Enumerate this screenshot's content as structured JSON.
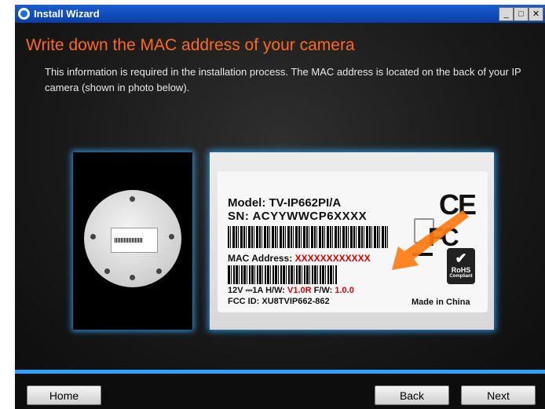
{
  "window": {
    "title": "Install Wizard",
    "controls": {
      "minimize": "_",
      "maximize": "□",
      "close": "✕"
    }
  },
  "main": {
    "heading": "Write down the MAC address of your camera",
    "description": "This information is required in the installation process. The MAC address is located on the back of your IP camera (shown in photo below)."
  },
  "label": {
    "model": "Model: TV-IP662PI/A",
    "sn": "SN: ACYYWWCP6XXXX",
    "mac_prefix": "MAC Address: ",
    "mac_value": "XXXXXXXXXXXX",
    "power_prefix": "12V ⎓1A  H/W: ",
    "hw_value": "V1.0R",
    "fw_prefix": "  F/W: ",
    "fw_value": "1.0.0",
    "fcc": "FCC ID: XU8TVIP662-862",
    "made_in": "Made in China",
    "ce": "CE",
    "fc": "FC",
    "rohs": "RoHS",
    "rohs_sub": "Compliant"
  },
  "buttons": {
    "home": "Home",
    "back": "Back",
    "next": "Next"
  },
  "colors": {
    "accent": "#ff6a1a",
    "highlight": "#2aa3ff",
    "title_bar": "#0a3ea8"
  }
}
